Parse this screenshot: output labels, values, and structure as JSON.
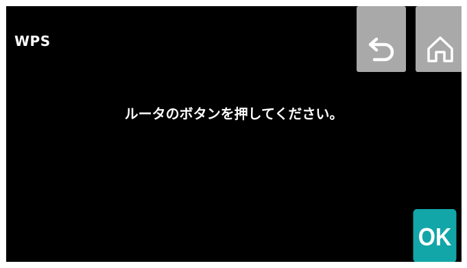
{
  "header": {
    "title": "WPS"
  },
  "toolbar": {
    "back_icon": "back-arrow-icon",
    "home_icon": "home-icon"
  },
  "main": {
    "message": "ルータのボタンを押してください。"
  },
  "actions": {
    "ok_label": "OK"
  },
  "colors": {
    "background": "#000000",
    "toolbar_button": "#a9a9a9",
    "ok_button": "#12a6a8",
    "text": "#ffffff"
  }
}
